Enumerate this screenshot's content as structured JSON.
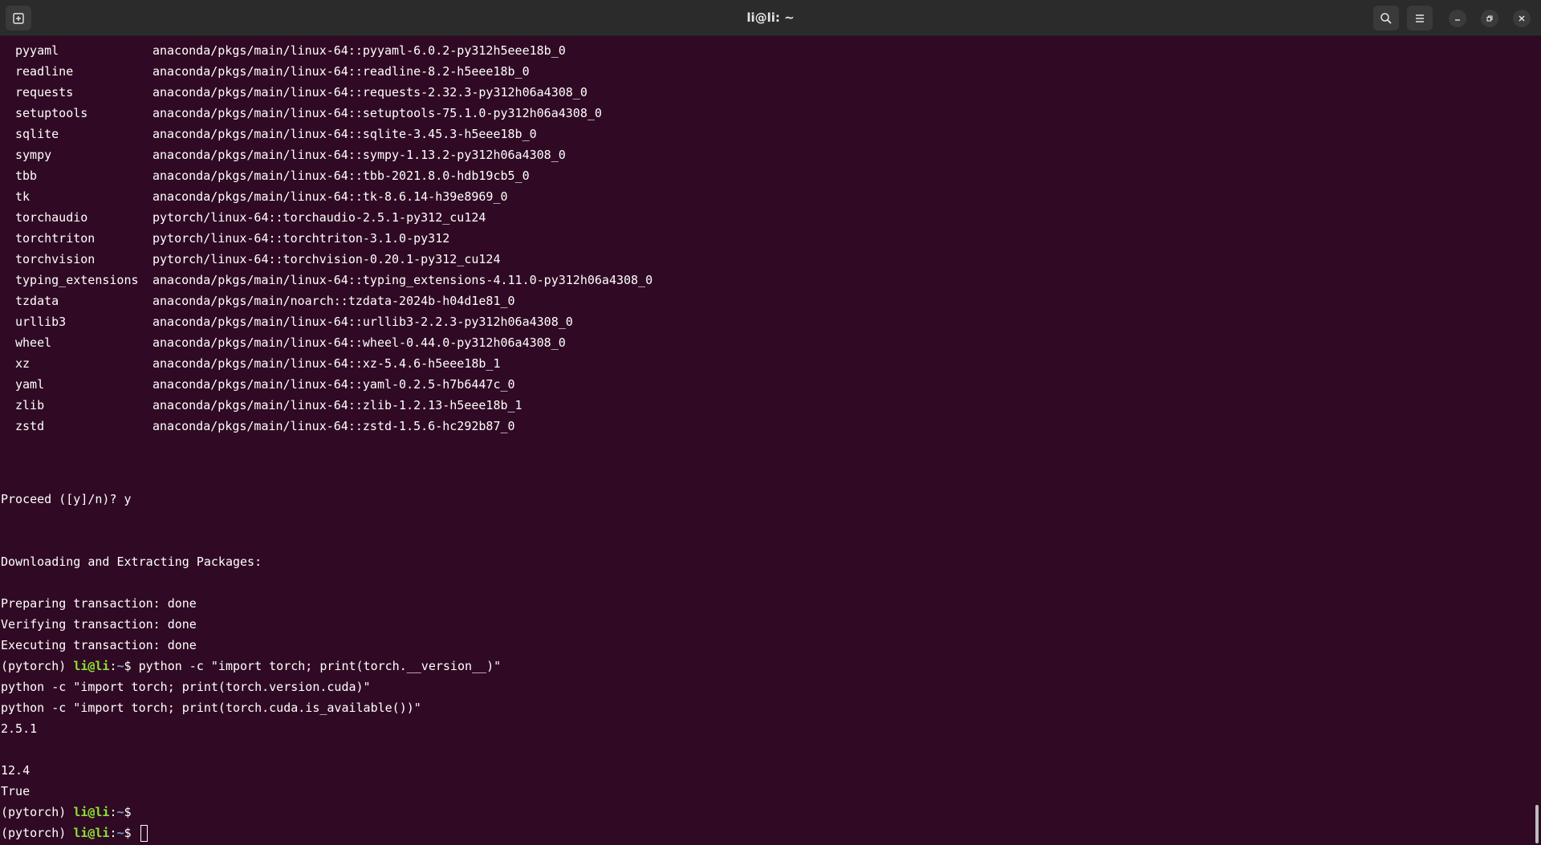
{
  "window": {
    "title": "li@li: ~"
  },
  "colors": {
    "background": "#300a24",
    "prompt_user": "#8ae234",
    "prompt_path": "#729fcf"
  },
  "packages": [
    {
      "name": "pyyaml",
      "source": "anaconda/pkgs/main/linux-64::pyyaml-6.0.2-py312h5eee18b_0"
    },
    {
      "name": "readline",
      "source": "anaconda/pkgs/main/linux-64::readline-8.2-h5eee18b_0"
    },
    {
      "name": "requests",
      "source": "anaconda/pkgs/main/linux-64::requests-2.32.3-py312h06a4308_0"
    },
    {
      "name": "setuptools",
      "source": "anaconda/pkgs/main/linux-64::setuptools-75.1.0-py312h06a4308_0"
    },
    {
      "name": "sqlite",
      "source": "anaconda/pkgs/main/linux-64::sqlite-3.45.3-h5eee18b_0"
    },
    {
      "name": "sympy",
      "source": "anaconda/pkgs/main/linux-64::sympy-1.13.2-py312h06a4308_0"
    },
    {
      "name": "tbb",
      "source": "anaconda/pkgs/main/linux-64::tbb-2021.8.0-hdb19cb5_0"
    },
    {
      "name": "tk",
      "source": "anaconda/pkgs/main/linux-64::tk-8.6.14-h39e8969_0"
    },
    {
      "name": "torchaudio",
      "source": "pytorch/linux-64::torchaudio-2.5.1-py312_cu124"
    },
    {
      "name": "torchtriton",
      "source": "pytorch/linux-64::torchtriton-3.1.0-py312"
    },
    {
      "name": "torchvision",
      "source": "pytorch/linux-64::torchvision-0.20.1-py312_cu124"
    },
    {
      "name": "typing_extensions",
      "source": "anaconda/pkgs/main/linux-64::typing_extensions-4.11.0-py312h06a4308_0"
    },
    {
      "name": "tzdata",
      "source": "anaconda/pkgs/main/noarch::tzdata-2024b-h04d1e81_0"
    },
    {
      "name": "urllib3",
      "source": "anaconda/pkgs/main/linux-64::urllib3-2.2.3-py312h06a4308_0"
    },
    {
      "name": "wheel",
      "source": "anaconda/pkgs/main/linux-64::wheel-0.44.0-py312h06a4308_0"
    },
    {
      "name": "xz",
      "source": "anaconda/pkgs/main/linux-64::xz-5.4.6-h5eee18b_1"
    },
    {
      "name": "yaml",
      "source": "anaconda/pkgs/main/linux-64::yaml-0.2.5-h7b6447c_0"
    },
    {
      "name": "zlib",
      "source": "anaconda/pkgs/main/linux-64::zlib-1.2.13-h5eee18b_1"
    },
    {
      "name": "zstd",
      "source": "anaconda/pkgs/main/linux-64::zstd-1.5.6-hc292b87_0"
    }
  ],
  "output": {
    "proceed": "Proceed ([y]/n)? y",
    "downloading": "Downloading and Extracting Packages:",
    "preparing": "Preparing transaction: done",
    "verifying": "Verifying transaction: done",
    "executing": "Executing transaction: done",
    "cmd2": "python -c \"import torch; print(torch.version.cuda)\"",
    "cmd3": "python -c \"import torch; print(torch.cuda.is_available())\"",
    "out_version": "2.5.1",
    "out_cuda": "12.4",
    "out_available": "True"
  },
  "prompt": {
    "env": "(pytorch) ",
    "user": "li@li",
    "sep": ":",
    "path": "~",
    "dollar": "$ ",
    "cmd1": "python -c \"import torch; print(torch.__version__)\""
  }
}
